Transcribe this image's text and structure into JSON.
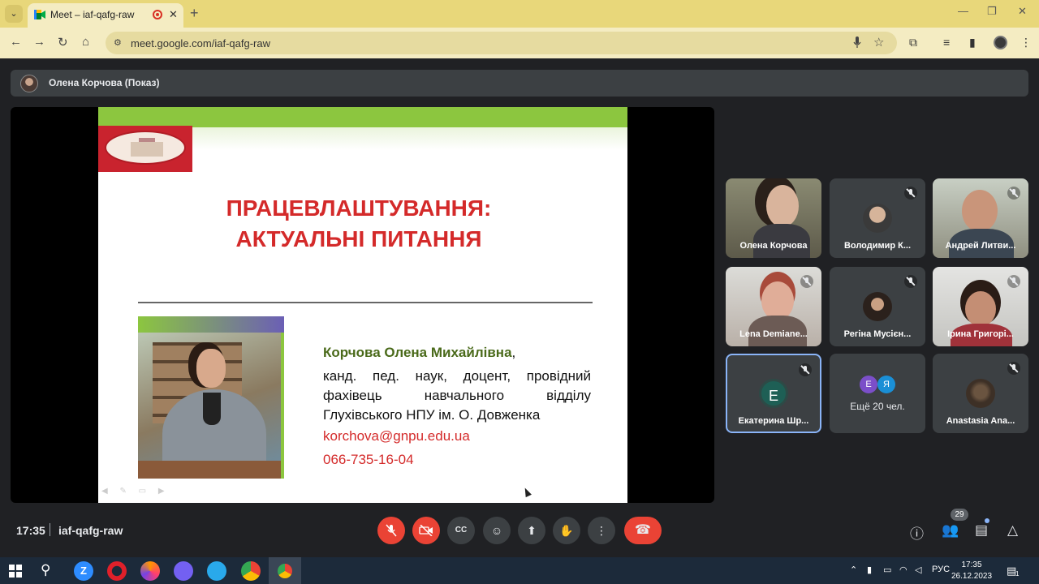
{
  "browser": {
    "tab_title": "Meet – iaf-qafg-raw",
    "url": "meet.google.com/iaf-qafg-raw",
    "new_tab": "+",
    "close_tab": "✕"
  },
  "meet": {
    "presenter_label": "Олена Корчова (Показ)",
    "time": "17:35",
    "meeting_code": "iaf-qafg-raw",
    "people_count": "29"
  },
  "slide": {
    "title_line1": "ПРАЦЕВЛАШТУВАННЯ:",
    "title_line2": "АКТУАЛЬНІ ПИТАННЯ",
    "name": "Корчова Олена Михайлівна",
    "name_suffix": ",",
    "bio": "канд. пед. наук, доцент, провідний фахівець навчального відділу Глухівського НПУ ім. О. Довженка",
    "email": "korchova@gnpu.edu.ua",
    "phone": "066-735-16-04"
  },
  "participants": [
    {
      "name": "Олена Корчова"
    },
    {
      "name": "Володимир К..."
    },
    {
      "name": "Андрей Литви..."
    },
    {
      "name": "Lena Demiane..."
    },
    {
      "name": "Регіна Мусієн..."
    },
    {
      "name": "Ірина Григорі..."
    },
    {
      "name": "Екатерина Шр...",
      "initial": "Е"
    },
    {
      "name": "Ещё 20 чел.",
      "initials": [
        "Е",
        "Я"
      ]
    },
    {
      "name": "Anastasia Ana..."
    }
  ],
  "taskbar": {
    "language": "РУС",
    "time": "17:35",
    "date": "26.12.2023",
    "notification_count": "1"
  },
  "colors": {
    "meet_red": "#ea4335",
    "slide_red": "#d42a2a",
    "slide_green": "#8cc63f",
    "active_tile_border": "#8ab4f8"
  }
}
